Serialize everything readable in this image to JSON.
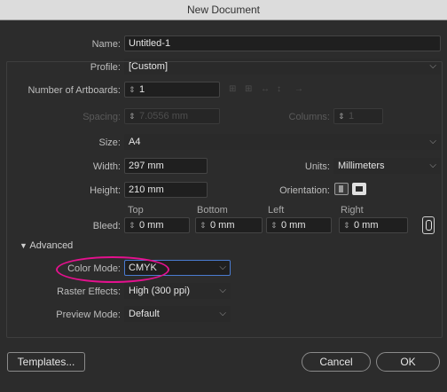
{
  "window": {
    "title": "New Document"
  },
  "name": {
    "label": "Name:",
    "value": "Untitled-1"
  },
  "profile": {
    "label": "Profile:",
    "value": "[Custom]"
  },
  "artboards": {
    "label": "Number of Artboards:",
    "value": "1"
  },
  "spacing": {
    "label": "Spacing:",
    "value": "7.0556 mm"
  },
  "columns": {
    "label": "Columns:",
    "value": "1"
  },
  "size": {
    "label": "Size:",
    "value": "A4"
  },
  "width": {
    "label": "Width:",
    "value": "297 mm"
  },
  "units": {
    "label": "Units:",
    "value": "Millimeters"
  },
  "height": {
    "label": "Height:",
    "value": "210 mm"
  },
  "orientation": {
    "label": "Orientation:",
    "selected": "portrait"
  },
  "bleed": {
    "label": "Bleed:",
    "top_label": "Top",
    "top": "0 mm",
    "bottom_label": "Bottom",
    "bottom": "0 mm",
    "left_label": "Left",
    "left": "0 mm",
    "right_label": "Right",
    "right": "0 mm"
  },
  "advanced": {
    "label": "Advanced",
    "color_mode_label": "Color Mode:",
    "color_mode": "CMYK",
    "raster_label": "Raster Effects:",
    "raster": "High (300 ppi)",
    "preview_label": "Preview Mode:",
    "preview": "Default"
  },
  "buttons": {
    "templates": "Templates...",
    "cancel": "Cancel",
    "ok": "OK"
  },
  "colors": {
    "highlight_ring": "#e4118e",
    "focus_border": "#4a7bd0"
  }
}
